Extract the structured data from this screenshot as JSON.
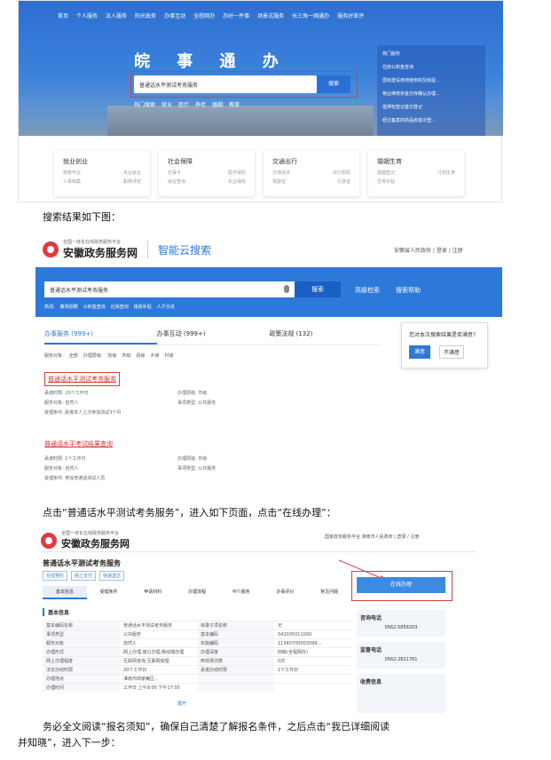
{
  "shot1": {
    "nav": [
      "首页",
      "个人服务",
      "法人服务",
      "阳光政务",
      "办事互动",
      "全程网办",
      "办好一件事",
      "场景式服务",
      "长三角一网通办",
      "服务好差评"
    ],
    "title": "皖 事 通 办",
    "search_value": "普通话水平测试考务服务",
    "search_button": "搜索",
    "hot": [
      "热门搜索",
      "就业",
      "医疗",
      "养老",
      "婚姻",
      "教育"
    ],
    "side_title": "热门服务",
    "side_items": [
      "住房公积金查询",
      "国有建设用地使用权及房屋...",
      "物业维修资金交存确认办理...",
      "抵押权登记首次登记",
      "经过备案的商品房首次登..."
    ],
    "cats": [
      {
        "name": "就业创业",
        "items": [
          "高校毕业",
          "失业就业",
          "人事档案",
          "职称评定"
        ]
      },
      {
        "name": "社会保障",
        "items": [
          "社保卡",
          "医疗保险",
          "综合查询",
          "失业保险"
        ]
      },
      {
        "name": "交通出行",
        "items": [
          "交通违法",
          "出行帮助",
          "驾驶证",
          "行驶证"
        ]
      },
      {
        "name": "婚姻生育",
        "items": [
          "婚姻登记",
          "计划生育",
          "生育补贴",
          ""
        ]
      }
    ]
  },
  "text1": "搜索结果如下图：",
  "shot2": {
    "logo_small": "全国一体化在线政务服务平台",
    "logo_big": "安徽政务服务网",
    "brand": "智能云搜索",
    "toplinks": "安徽省人民政府 | 登录 / 注册",
    "search_value": "普通话水平测试考务服务",
    "search_button": "搜索",
    "adv": "高级检索",
    "help": "搜索帮助",
    "hotlinks": [
      "热词:",
      "教师招聘",
      "公积金查询",
      "社保查询",
      "租房补贴",
      "人才引进"
    ],
    "tabs": [
      "办事服务 (999+)",
      "办事互动 (999+)",
      "政策法规 (132)"
    ],
    "filter": [
      "服务对象:",
      "全部",
      "办理层级:",
      "省级",
      "市级",
      "县级",
      "乡级",
      "村级"
    ],
    "survey_q": "您对本次搜索结果是否满意?",
    "survey_yes": "满意",
    "survey_no": "不满意",
    "results": [
      {
        "title": "普通话水平测试考务服务",
        "rows": [
          [
            "承诺时限: 20个工作日",
            "办理层级: 市级"
          ],
          [
            "服务对象: 自然人",
            "事项类型: 公共服务"
          ],
          [
            "受理条件: 距离本人上次参加测试3个月",
            ""
          ]
        ]
      },
      {
        "title": "普通话水平考试结果查询",
        "rows": [
          [
            "承诺时限: 1个工作日",
            "办理层级: 市级"
          ],
          [
            "服务对象: 自然人",
            "事项类型: 公共服务"
          ],
          [
            "受理条件: 参加普通话测试人员",
            ""
          ]
        ]
      }
    ]
  },
  "text2": "点击“普通话水平测试考务服务”，进入如下页面，点击“在线办理”：",
  "shot3": {
    "logo_small": "全国一体化在线政务服务平台",
    "logo_big": "安徽政务服务网",
    "toplinks": "国家政务服务平台 淮南市人民政府 | 登录 / 注册",
    "page_title": "普通话水平测试考务服务",
    "badges": [
      "在线预约",
      "网上支付",
      "快递送达"
    ],
    "tabs": [
      "基本信息",
      "受理条件",
      "申请材料",
      "办理流程",
      "中介服务",
      "办事评价",
      "常见问题"
    ],
    "section": "基本信息",
    "grid": [
      [
        "基本编码名称",
        "普通话水平测试考务服务",
        "目录子项名称",
        "无"
      ],
      [
        "事项类型",
        "公共服务",
        "基本编码",
        "342005011000"
      ],
      [
        "服务对象",
        "自然人",
        "实施编码",
        "11340700003099..."
      ],
      [
        "办理形式",
        "网上办理,窗口办理,移动端办理",
        "办理深度",
        "四级(全程网办)"
      ],
      [
        "网上办理程度",
        "互联网咨询,互联网受理",
        "到现场次数",
        "0次"
      ],
      [
        "法定办结时限",
        "20个工作日",
        "承诺办结时限",
        "1个工作日"
      ],
      [
        "办理地点",
        "淮南市田家庵区...",
        "",
        ""
      ],
      [
        "办理时间",
        "工作日 上午9:00 下午17:00",
        "",
        ""
      ]
    ],
    "online_button": "在线办理",
    "consult_label": "咨询电话",
    "consult_phone": "0562-5858203",
    "complain_label": "监督电话",
    "complain_phone": "0562-2821761",
    "fee_label": "收费信息",
    "more": "展开"
  },
  "text3a": "务必全文阅读“报名须知”，确保自己清楚了解报名条件，之后点击“我已详细阅读",
  "text3b": "并知晓”，进入下一步："
}
